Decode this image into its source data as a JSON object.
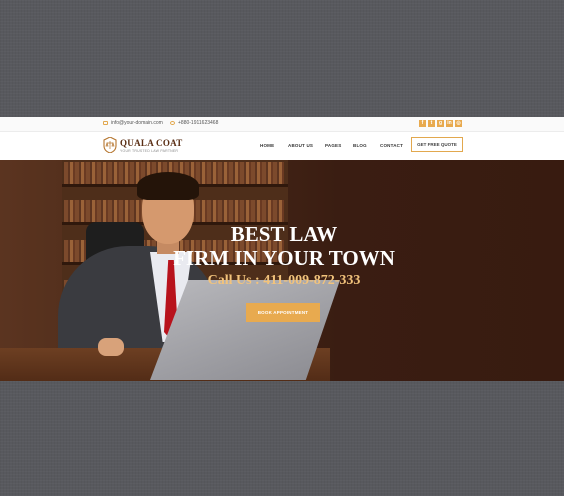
{
  "topbar": {
    "email": "info@your-domain.com",
    "phone": "+880-1911623468",
    "social": [
      {
        "icon": "facebook-icon",
        "glyph": "f"
      },
      {
        "icon": "twitter-icon",
        "glyph": "t"
      },
      {
        "icon": "google-plus-icon",
        "glyph": "g"
      },
      {
        "icon": "linkedin-icon",
        "glyph": "in"
      },
      {
        "icon": "instagram-icon",
        "glyph": "◎"
      }
    ]
  },
  "header": {
    "brand": "QUALA COAT",
    "tagline": "YOUR TRUSTED LAW PARTNER",
    "nav": [
      "HOME",
      "ABOUT US",
      "PAGES",
      "BLOG",
      "CONTACT"
    ],
    "quote_button": "GET FREE QUOTE"
  },
  "hero": {
    "title_line1": "BEST LAW",
    "title_line2": "FIRM IN YOUR TOWN",
    "phone": "Call Us : 411-009-872-333",
    "button": "BOOK APPOINTMENT"
  },
  "colors": {
    "accent": "#e8aa4f",
    "brand": "#5a2e14",
    "phone_text": "#f2c37c"
  }
}
